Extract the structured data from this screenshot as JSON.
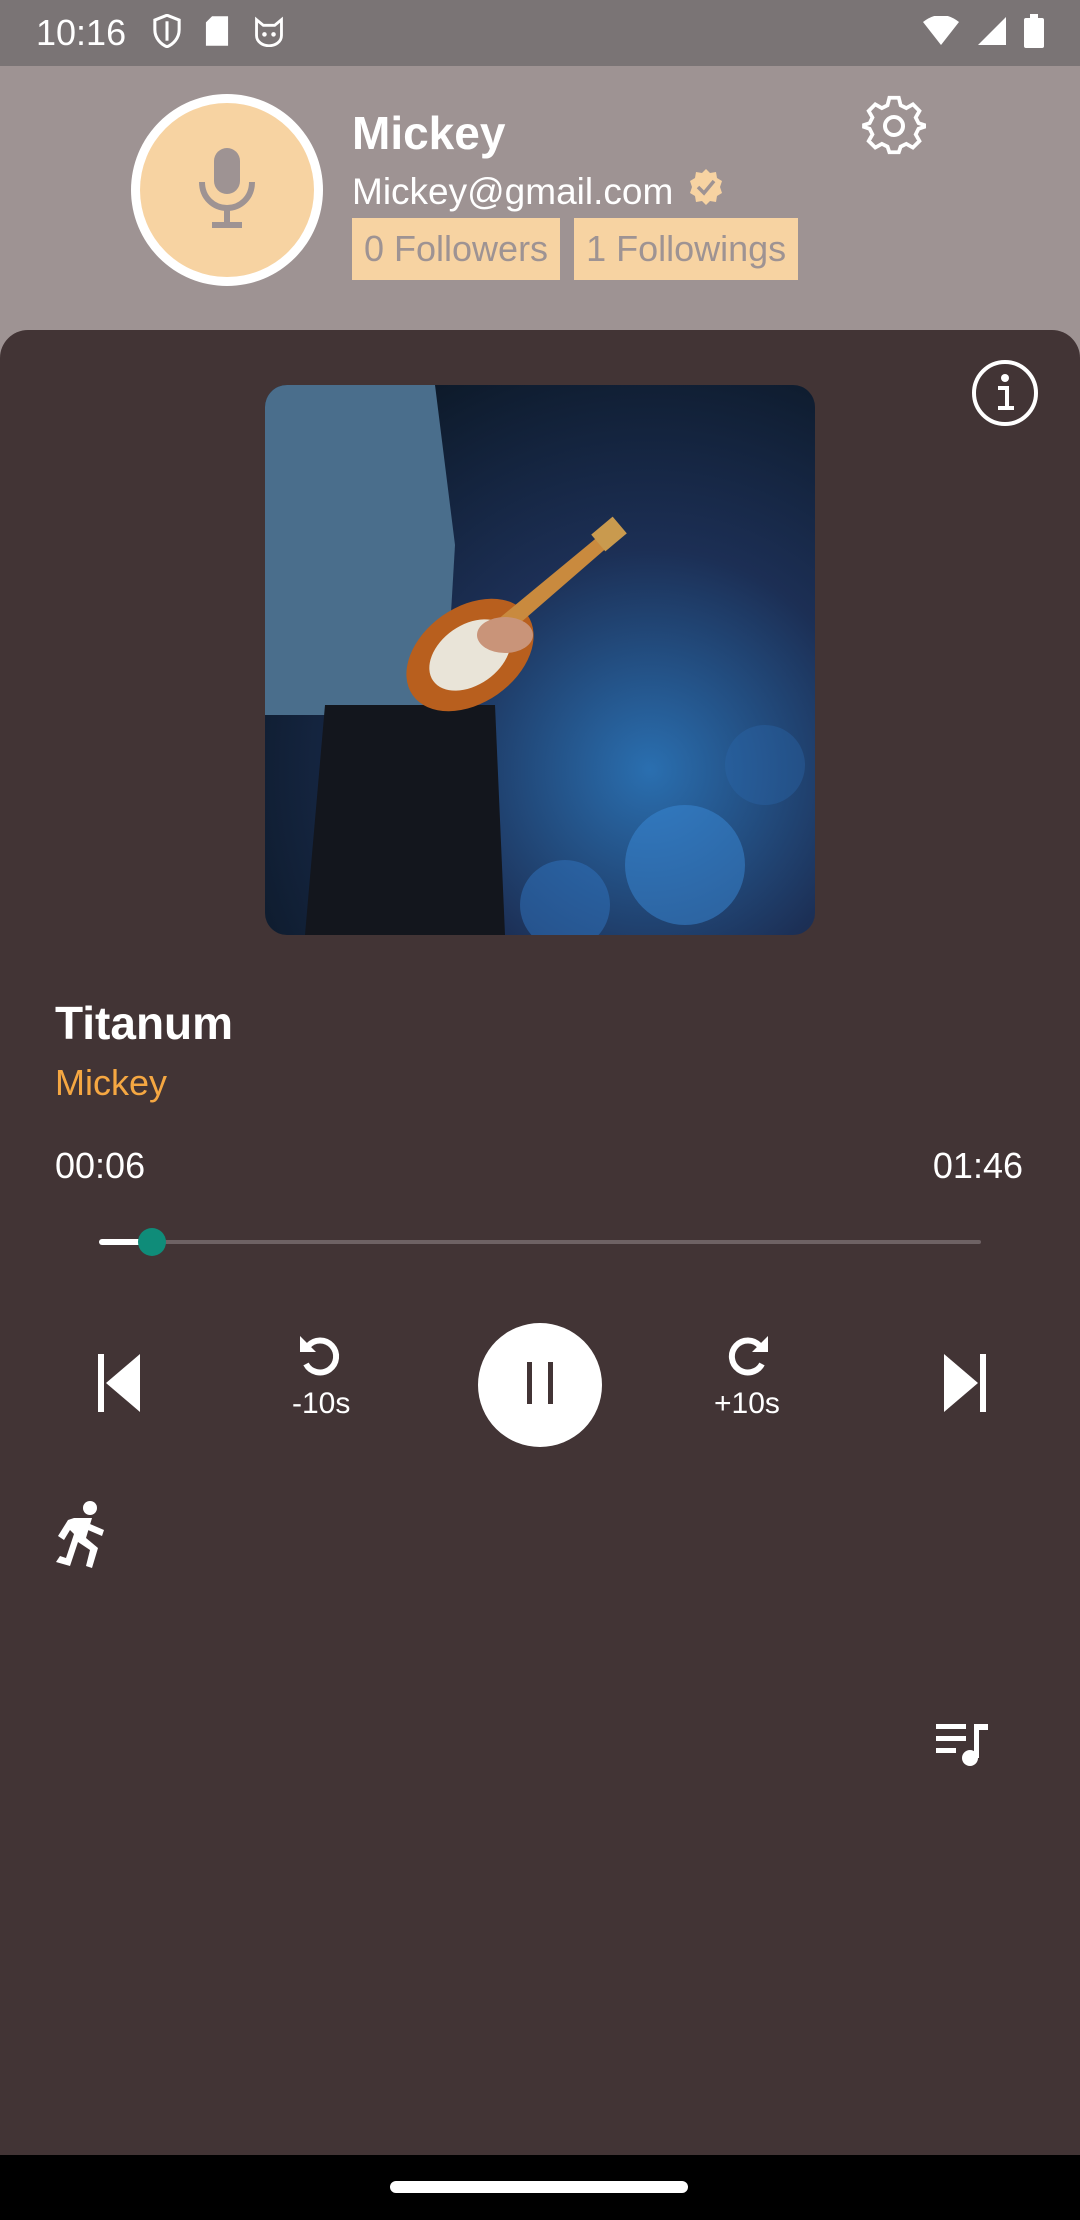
{
  "status_bar": {
    "time": "10:16",
    "left_icons": [
      "shield-icon",
      "sd-card-icon",
      "cat-icon"
    ],
    "right_icons": [
      "wifi-icon",
      "signal-icon",
      "battery-icon"
    ]
  },
  "profile": {
    "name": "Mickey",
    "email": "Mickey@gmail.com",
    "verified_icon": "verified-check-icon",
    "followers_label": "0 Followers",
    "followings_label": "1 Followings",
    "avatar_icon": "microphone-icon",
    "settings_icon": "gear-icon"
  },
  "player": {
    "info_icon": "info-icon",
    "album_art_desc": "guitarist on stage",
    "title": "Titanum",
    "artist": "Mickey",
    "time_current": "00:06",
    "time_total": "01:46",
    "progress_fraction": 0.06,
    "rewind_label": "-10s",
    "forward_label": "+10s",
    "controls": [
      "skip-previous-icon",
      "replay-10-icon",
      "pause-icon",
      "forward-10-icon",
      "skip-next-icon"
    ],
    "speed_icon": "running-person-icon",
    "queue_icon": "queue-music-icon"
  },
  "colors": {
    "header_bg": "#9e9393",
    "card_bg": "#423435",
    "accent_orange": "#f5a742",
    "badge_bg": "#f7d3a2",
    "thumb_teal": "#0f8c79"
  }
}
